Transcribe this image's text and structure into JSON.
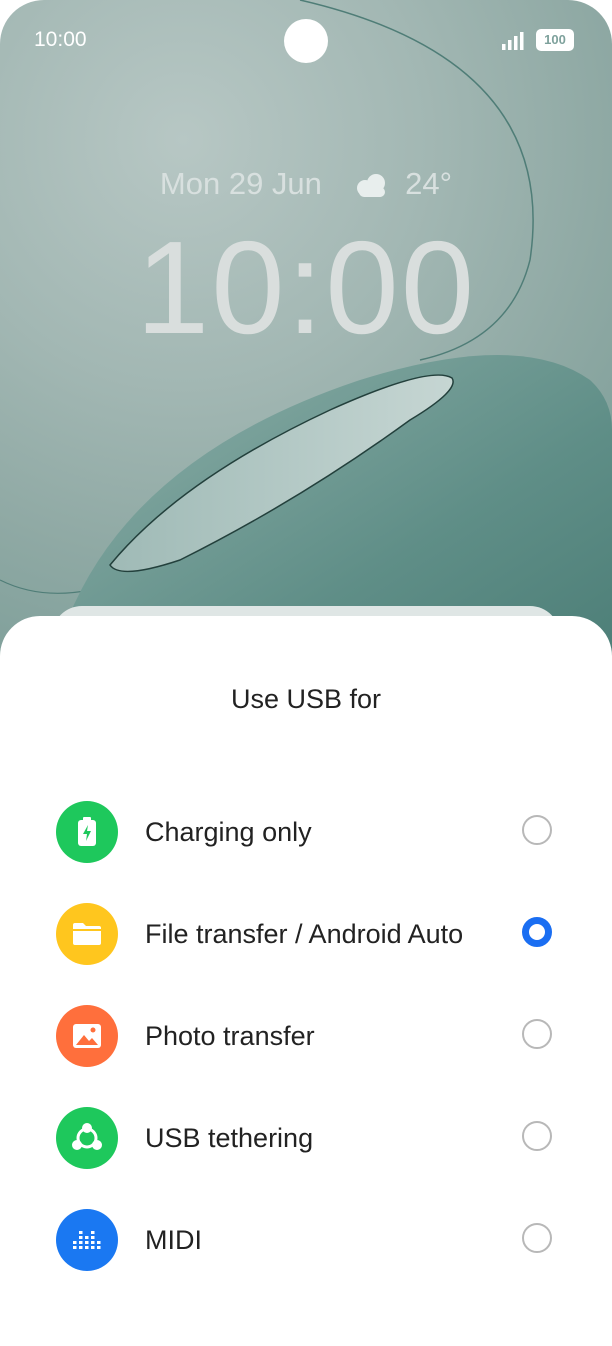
{
  "status_bar": {
    "time": "10:00",
    "battery": "100"
  },
  "lock_screen": {
    "date": "Mon 29 Jun",
    "temperature": "24°",
    "clock": "10:00",
    "weather_icon": "cloud-icon"
  },
  "sheet": {
    "title": "Use USB for",
    "options": [
      {
        "label": "Charging only",
        "icon": "battery-charging-icon",
        "color": "#1ec85c",
        "selected": false
      },
      {
        "label": "File transfer / Android Auto",
        "icon": "folder-icon",
        "color": "#ffc61e",
        "selected": true
      },
      {
        "label": "Photo transfer",
        "icon": "image-icon",
        "color": "#ff6f3c",
        "selected": false
      },
      {
        "label": "USB tethering",
        "icon": "share-network-icon",
        "color": "#1ec85c",
        "selected": false
      },
      {
        "label": "MIDI",
        "icon": "equalizer-icon",
        "color": "#1a78f2",
        "selected": false
      }
    ],
    "accent": "#1a6ef2"
  }
}
